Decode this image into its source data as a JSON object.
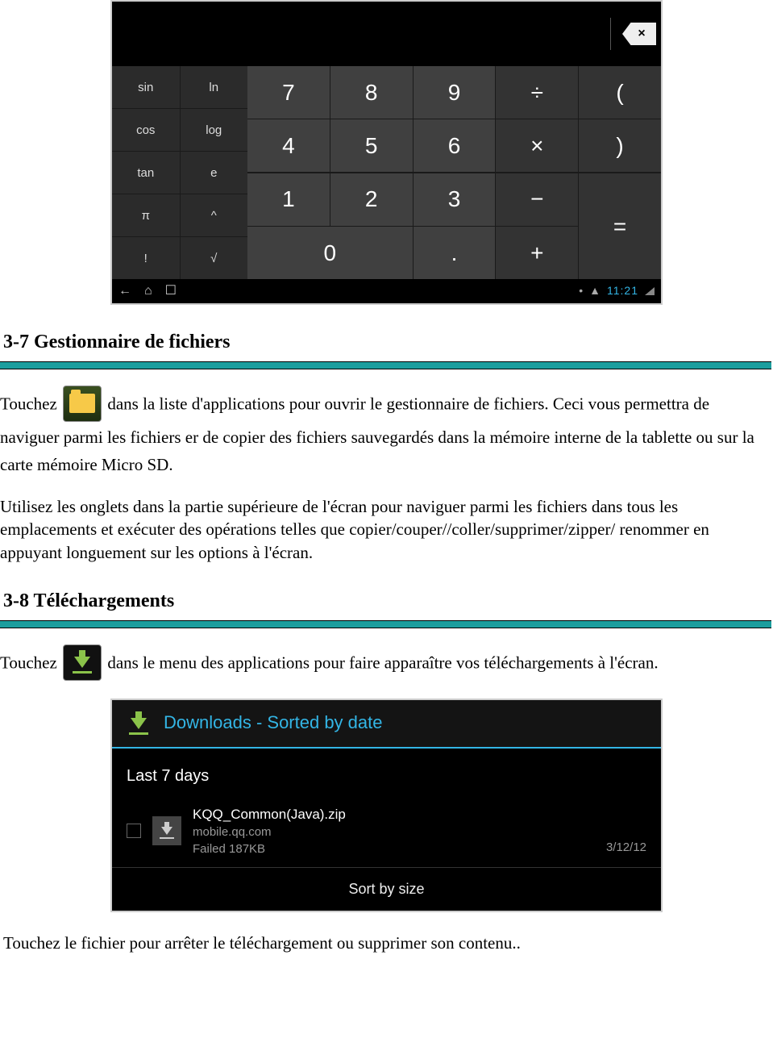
{
  "calculator": {
    "sci_keys": [
      "sin",
      "ln",
      "cos",
      "log",
      "tan",
      "e",
      "π",
      "^",
      "!",
      "√"
    ],
    "numpad": {
      "r1": [
        "7",
        "8",
        "9",
        "÷",
        "("
      ],
      "r2": [
        "4",
        "5",
        "6",
        "×",
        ")"
      ],
      "r3": [
        "1",
        "2",
        "3",
        "−"
      ],
      "eq": "=",
      "r4": [
        "0",
        ".",
        "+"
      ]
    },
    "delete_glyph": "×",
    "navbar_time": "11:21",
    "nav_back": "←",
    "nav_home": "⌂",
    "nav_recent": "☐",
    "nav_dot": "•",
    "nav_warn": "▲"
  },
  "section37": {
    "heading": "3-7 Gestionnaire de fichiers",
    "p1a": "Touchez ",
    "p1b": " dans la liste d'applications pour ouvrir le gestionnaire de fichiers. Ceci vous permettra de naviguer parmi les fichiers er de copier des fichiers sauvegardés dans la mémoire interne de la tablette ou sur la carte mémoire Micro SD.",
    "p2": "Utilisez les onglets dans la partie supérieure de l'écran pour naviguer parmi les fichiers dans tous les emplacements et exécuter des opérations telles que copier/couper//coller/supprimer/zipper/ renommer en appuyant longuement sur les options à l'écran."
  },
  "section38": {
    "heading": "3-8 Téléchargements",
    "p1a": "Touchez ",
    "p1b": " dans le menu des applications pour faire apparaître vos téléchargements à l'écran.",
    "p2": "Touchez le fichier pour arrêter le téléchargement ou supprimer son contenu.."
  },
  "downloads": {
    "header_title": "Downloads - Sorted by date",
    "section_label": "Last 7 days",
    "file": {
      "name": "KQQ_Common(Java).zip",
      "source": "mobile.qq.com",
      "status": "Failed   187KB",
      "date": "3/12/12"
    },
    "sort_label": "Sort by size"
  }
}
